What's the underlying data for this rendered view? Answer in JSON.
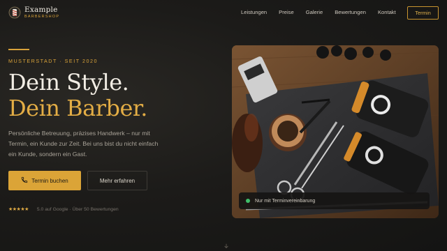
{
  "brand": {
    "name": "Example",
    "tagline": "BARBERSHOP",
    "logo_icon": "barber-logo-icon"
  },
  "nav": {
    "links": [
      "Leistungen",
      "Preise",
      "Galerie",
      "Bewertungen",
      "Kontakt"
    ],
    "cta": "Termin"
  },
  "hero": {
    "eyebrow": "MUSTERSTADT · SEIT 2020",
    "headline_1": "Dein Style.",
    "headline_2": "Dein Barber.",
    "description": "Persönliche Betreuung, präzises Handwerk – nur mit Termin, ein Kunde zur Zeit. Bei uns bist du nicht einfach ein Kunde, sondern ein Gast.",
    "primary_button": "Termin buchen",
    "primary_icon": "phone-icon",
    "secondary_button": "Mehr erfahren",
    "stars": "★★★★★",
    "rating_value": 5,
    "rating_text": "5.0 auf Google · Über 50 Bewertungen"
  },
  "image_badge": {
    "text": "Nur mit Terminvereinbarung",
    "status_color": "#3fbf6a"
  },
  "scroll_icon": "chevron-down-icon",
  "colors": {
    "accent": "#d9a33a",
    "background": "#1c1b19",
    "text": "#f2ede4"
  }
}
